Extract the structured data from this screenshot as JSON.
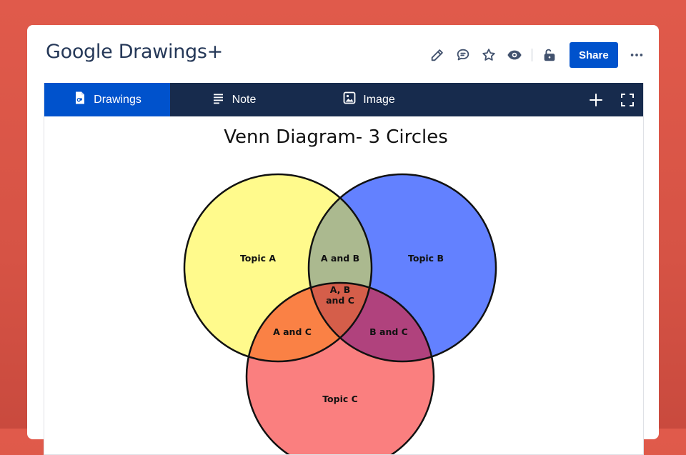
{
  "app": {
    "title": "Google Drawings+"
  },
  "toolbar": {
    "icons": [
      "pencil-icon",
      "comment-icon",
      "star-icon",
      "eye-icon",
      "unlock-icon",
      "more-icon"
    ],
    "share_label": "Share"
  },
  "tabs": [
    {
      "label": "Drawings",
      "icon": "drawing-file-icon",
      "active": true
    },
    {
      "label": "Note",
      "icon": "note-lines-icon",
      "active": false
    },
    {
      "label": "Image",
      "icon": "image-icon",
      "active": false
    }
  ],
  "tab_tools": [
    "plus-icon",
    "fullscreen-icon"
  ],
  "colors": {
    "background": "#dd5647",
    "brand": "#0052cc",
    "tabbar": "#172b4d",
    "circle_a": "#fffa8c",
    "circle_b": "#6381ff",
    "circle_c": "#fa7f7f",
    "ab": "#abb98f",
    "ac": "#fa8145",
    "bc": "#b0427d",
    "abc": "#d55e4a"
  },
  "diagram": {
    "title": "Venn Diagram- 3 Circles",
    "labels": {
      "a": "Topic A",
      "b": "Topic B",
      "c": "Topic C",
      "ab": "A and B",
      "ac": "A and C",
      "bc": "B and C",
      "abc_line1": "A, B",
      "abc_line2": "and C"
    }
  }
}
